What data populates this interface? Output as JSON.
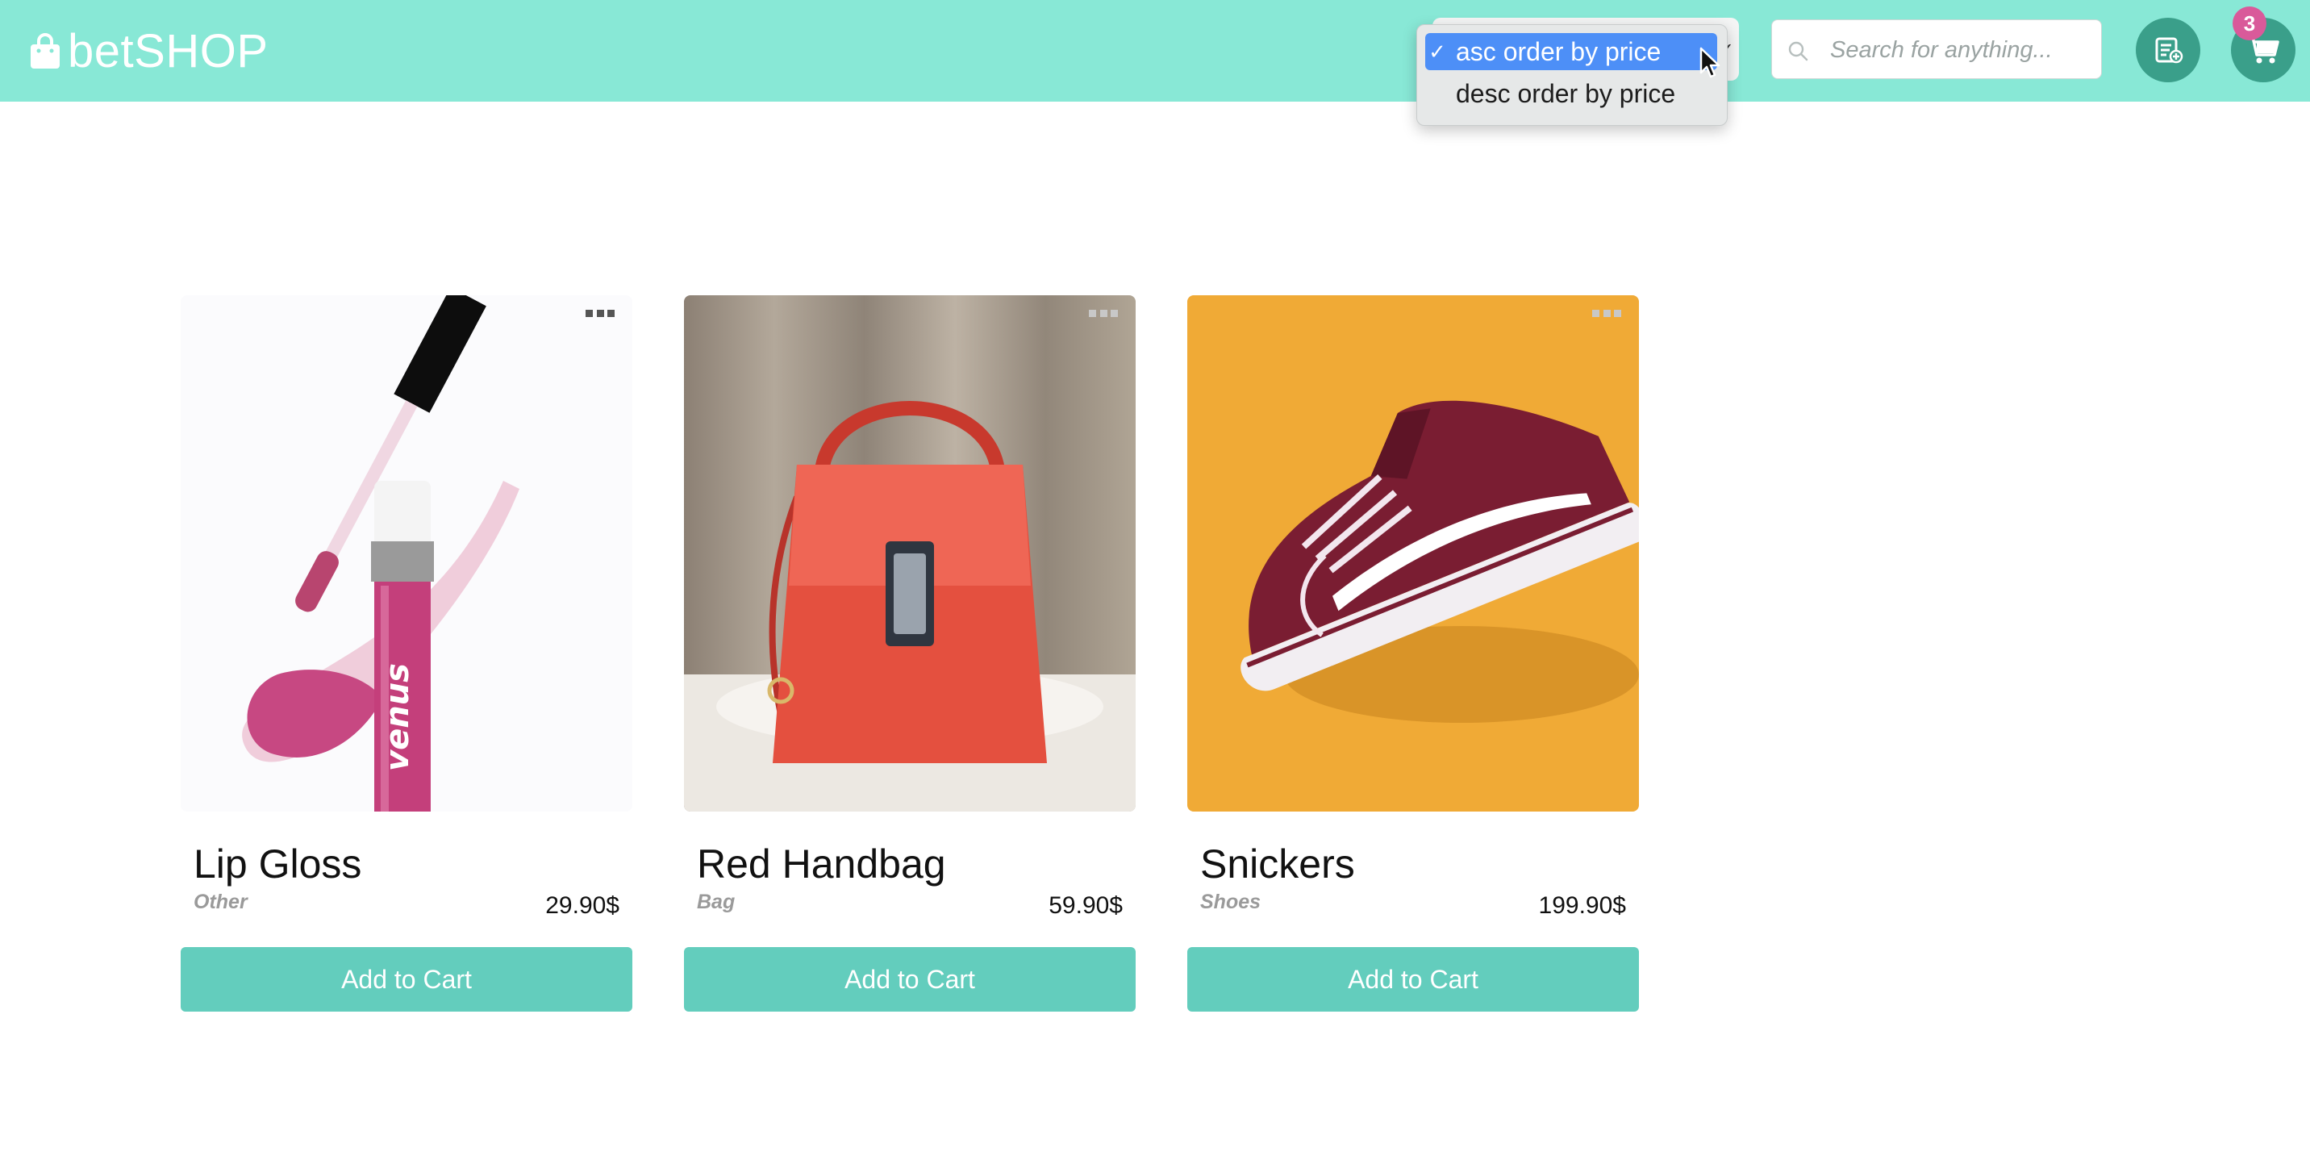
{
  "header": {
    "logo_text": "betSHOP",
    "logo_icon": "shopping-bag-icon",
    "background_color": "#88e8d6"
  },
  "sort": {
    "options": [
      {
        "label": "asc order by price",
        "selected": true
      },
      {
        "label": "desc order by price",
        "selected": false
      }
    ]
  },
  "search": {
    "placeholder": "Search for anything..."
  },
  "actions": {
    "orders_icon": "add-order-icon",
    "cart_icon": "cart-icon",
    "cart_count": "3"
  },
  "products": [
    {
      "name": "Lip Gloss",
      "category": "Other",
      "price": "29.90$",
      "button": "Add to Cart"
    },
    {
      "name": "Red Handbag",
      "category": "Bag",
      "price": "59.90$",
      "button": "Add to Cart"
    },
    {
      "name": "Snickers",
      "category": "Shoes",
      "price": "199.90$",
      "button": "Add to Cart"
    }
  ]
}
